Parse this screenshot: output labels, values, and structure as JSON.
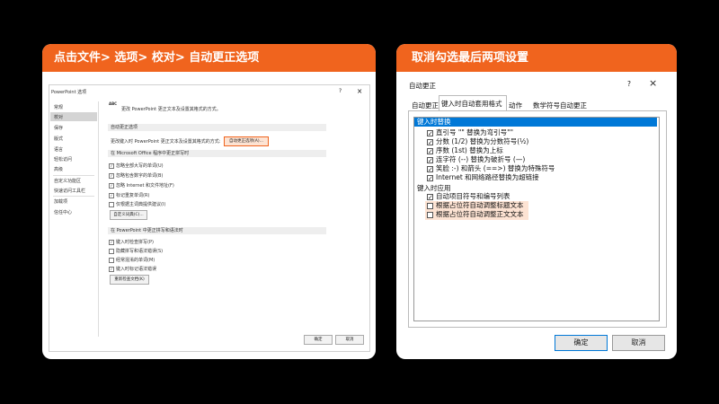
{
  "left_panel": {
    "banner": "点击文件> 选项> 校对> 自动更正选项",
    "dialog_title": "PowerPoint 选项",
    "help": "?",
    "close": "×",
    "nav": [
      "常规",
      "校对",
      "保存",
      "版式",
      "语言",
      "轻松访问",
      "高级",
      "自定义功能区",
      "快速访问工具栏",
      "加载项",
      "信任中心"
    ],
    "header_icon": "ABC",
    "header_text": "更改 PowerPoint 更正文本及设置其格式的方式。",
    "section1": "自动更正选项",
    "autocorrect_desc": "更改键入时 PowerPoint 更正文本及设置其格式的方式:",
    "autocorrect_button": "自动更正选项(A)...",
    "section2": "在 Microsoft Office 程序中更正拼写时",
    "office_options": [
      {
        "label": "忽略全部大写的单词(U)",
        "checked": true
      },
      {
        "label": "忽略包含数字的单词(B)",
        "checked": true
      },
      {
        "label": "忽略 Internet 和文件地址(F)",
        "checked": true
      },
      {
        "label": "标记重复单词(R)",
        "checked": true
      },
      {
        "label": "仅根据主词典提供建议(I)",
        "checked": false
      }
    ],
    "custom_dict_button": "自定义词典(C)...",
    "section3": "在 PowerPoint 中更正拼写和语法时",
    "ppt_options": [
      {
        "label": "键入时检查拼写(P)",
        "checked": true
      },
      {
        "label": "隐藏拼写和语法错误(S)",
        "checked": false
      },
      {
        "label": "经常混淆的单词(M)",
        "checked": false
      },
      {
        "label": "键入时标记语法错误",
        "checked": true
      }
    ],
    "recheck_button": "重新检查文档(K)",
    "ok": "确定",
    "cancel": "取消",
    "highlight_color": "#f0641e"
  },
  "right_panel": {
    "banner": "取消勾选最后两项设置",
    "dialog_title": "自动更正",
    "help": "?",
    "close": "×",
    "tabs": [
      "自动更正",
      "键入时自动套用格式",
      "动作",
      "数学符号自动更正"
    ],
    "active_tab": "键入时自动套用格式",
    "group1": "键入时替换",
    "replace_options": [
      {
        "label": "直引号 \"\" 替换为弯引号\"\"",
        "checked": true
      },
      {
        "label": "分数 (1/2) 替换为分数符号(½)",
        "checked": true
      },
      {
        "label": "序数 (1st) 替换为上标",
        "checked": true
      },
      {
        "label": "连字符 (--) 替换为破折号 (—)",
        "checked": true
      },
      {
        "label": "笑脸 :-) 和箭头 (==>) 替换为特殊符号",
        "checked": true
      },
      {
        "label": "Internet 和网络路径替换为超链接",
        "checked": true
      }
    ],
    "group2": "键入时应用",
    "apply_options": [
      {
        "label": "自动项目符号和编号列表",
        "checked": true
      },
      {
        "label": "根据占位符自动调整标题文本",
        "checked": false
      },
      {
        "label": "根据占位符自动调整正文文本",
        "checked": false
      }
    ],
    "ok": "确定",
    "cancel": "取消",
    "highlight_color": "#fde3d3"
  }
}
